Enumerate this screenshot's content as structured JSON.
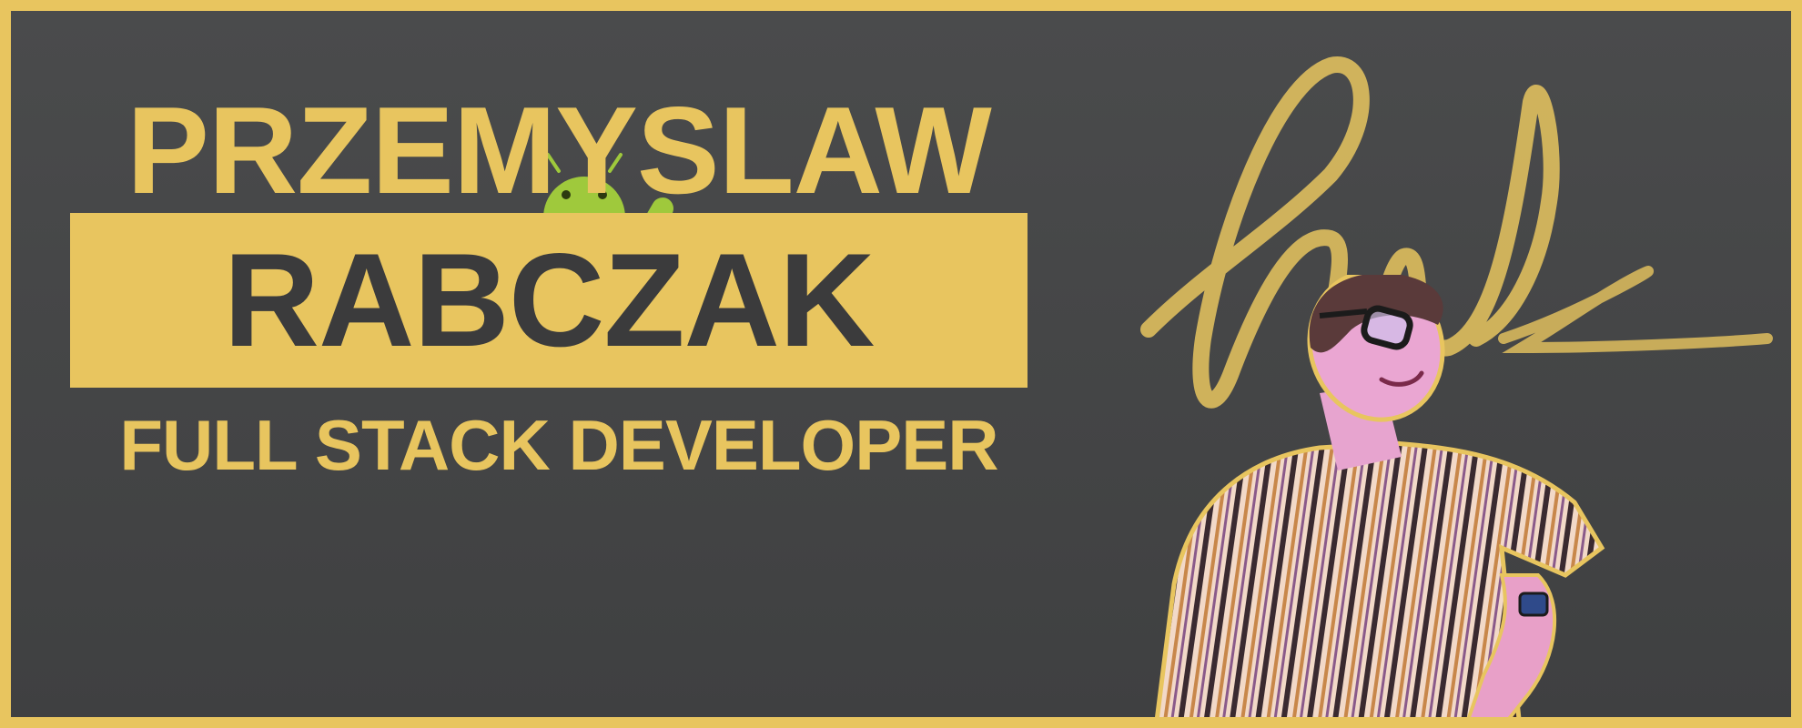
{
  "banner": {
    "first_name": "PRZEMYSLAW",
    "last_name": "RABCZAK",
    "role": "FULL STACK DEVELOPER"
  },
  "colors": {
    "accent": "#e8c55f",
    "background": "#454647",
    "dark_text": "#3b3b3c",
    "android_green": "#9fc93c"
  },
  "graphics": {
    "mascot": "android-robot-icon",
    "signature": "handwritten-signature",
    "portrait": "stylized-portrait-photo"
  }
}
